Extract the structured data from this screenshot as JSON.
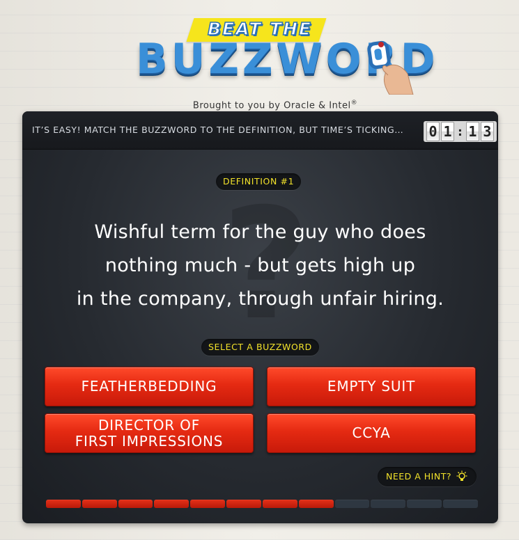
{
  "logo": {
    "beat_text": "BEAT THE",
    "buzz_text": "BUZZWORD",
    "tagline": "Brought to you by Oracle & Intel",
    "tagline_mark": "®"
  },
  "header": {
    "instructions": "IT’S EASY! MATCH THE BUZZWORD TO THE DEFINITION, BUT TIME’S TICKING…",
    "timer": {
      "d1": "0",
      "d2": "1",
      "sep": ":",
      "d3": "1",
      "d4": "3"
    }
  },
  "question": {
    "label": "DEFINITION #1",
    "text_line1": "Wishful term for the guy who does",
    "text_line2": "nothing much - but gets high up",
    "text_line3": "in the company, through unfair hiring."
  },
  "select_label": "SELECT A BUZZWORD",
  "answers": [
    {
      "line1": "FEATHERBEDDING",
      "line2": ""
    },
    {
      "line1": "EMPTY SUIT",
      "line2": ""
    },
    {
      "line1": "DIRECTOR OF",
      "line2": "FIRST IMPRESSIONS"
    },
    {
      "line1": "CCYA",
      "line2": ""
    }
  ],
  "hint_label": "NEED A HINT?",
  "progress": {
    "filled": 8,
    "total": 12
  },
  "colors": {
    "accent_yellow": "#f2e22a",
    "button_red": "#e52a12",
    "logo_blue": "#3a8fd8"
  },
  "icons": {
    "hint": "lightbulb-icon",
    "hand": "hand-holding-letter-icon"
  }
}
